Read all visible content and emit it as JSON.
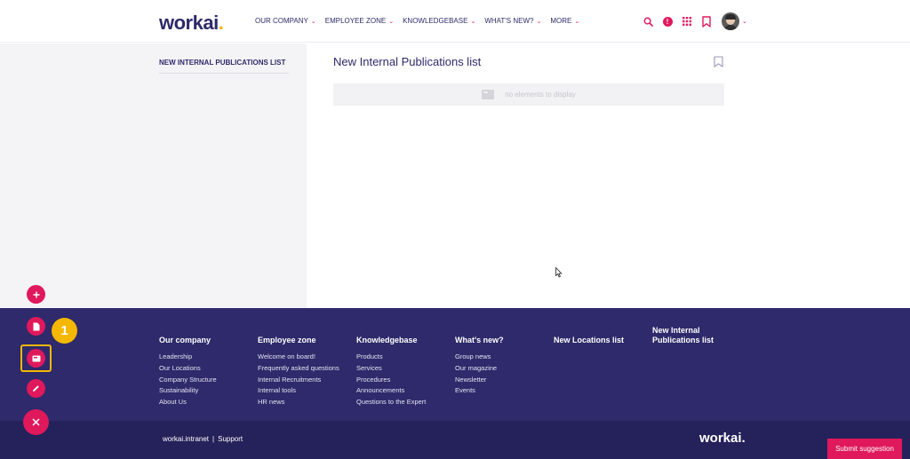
{
  "header": {
    "logo_text": "workai",
    "logo_dot": ".",
    "nav": [
      {
        "label": "OUR COMPANY"
      },
      {
        "label": "EMPLOYEE ZONE"
      },
      {
        "label": "KNOWLEDGEBASE"
      },
      {
        "label": "WHAT'S NEW?"
      },
      {
        "label": "MORE"
      }
    ],
    "alert_symbol": "!",
    "icons": [
      "search-icon",
      "alert-icon",
      "apps-grid-icon",
      "bookmark-icon",
      "avatar"
    ]
  },
  "sidebar": {
    "active_link": "NEW INTERNAL PUBLICATIONS LIST"
  },
  "main": {
    "title": "New Internal Publications list",
    "empty_text": "no elements to display"
  },
  "footer": {
    "columns": [
      {
        "title": "Our company",
        "links": [
          "Leadership",
          "Our Locations",
          "Company Structure",
          "Sustainability",
          "About Us"
        ]
      },
      {
        "title": "Employee zone",
        "links": [
          "Welcome on board!",
          "Frequently asked questions",
          "Internal Recruitments",
          "Internal tools",
          "HR news"
        ]
      },
      {
        "title": "Knowledgebase",
        "links": [
          "Products",
          "Services",
          "Procedures",
          "Announcements",
          "Questions to the Expert"
        ]
      },
      {
        "title": "What's new?",
        "links": [
          "Group news",
          "Our magazine",
          "Newsletter",
          "Events"
        ]
      },
      {
        "title": "New Locations list",
        "links": []
      },
      {
        "title_line1": "New Internal",
        "title_line2": "Publications list",
        "links": []
      }
    ],
    "bottom_link_1": "workai.intranet",
    "bottom_sep": "|",
    "bottom_link_2": "Support",
    "logo_text": "workai."
  },
  "submit_button": "Submit suggestion",
  "step_badge": "1",
  "colors": {
    "brand_navy": "#2e2a6b",
    "accent_pink": "#e0185c",
    "highlight_yellow": "#f5b800"
  }
}
